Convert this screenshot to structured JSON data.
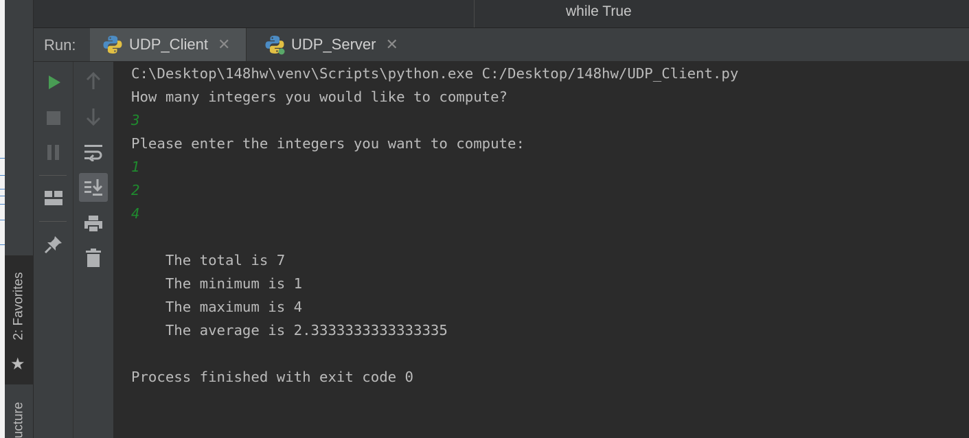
{
  "editor": {
    "code_text": "while True"
  },
  "run_panel": {
    "label": "Run:",
    "tabs": [
      {
        "label": "UDP_Client",
        "active": true
      },
      {
        "label": "UDP_Server",
        "active": false,
        "running": true
      }
    ]
  },
  "toolbar_left": [
    "run-icon",
    "stop-icon",
    "pause-icon",
    "layout-icon",
    "pin-icon"
  ],
  "toolbar_right": [
    "arrow-up-icon",
    "arrow-down-icon",
    "soft-wrap-icon",
    "scroll-to-end-icon",
    "print-icon",
    "trash-icon"
  ],
  "side_tabs": {
    "favorites": "2: Favorites",
    "structure": "ucture"
  },
  "console": {
    "lines": [
      {
        "text": "C:\\Desktop\\148hw\\venv\\Scripts\\python.exe C:/Desktop/148hw/UDP_Client.py",
        "kind": "output"
      },
      {
        "text": "How many integers you would like to compute?",
        "kind": "output"
      },
      {
        "text": "3",
        "kind": "input"
      },
      {
        "text": "Please enter the integers you want to compute:",
        "kind": "output"
      },
      {
        "text": "1",
        "kind": "input"
      },
      {
        "text": "2",
        "kind": "input"
      },
      {
        "text": "4",
        "kind": "input"
      },
      {
        "text": "",
        "kind": "output"
      },
      {
        "text": "    The total is 7",
        "kind": "output"
      },
      {
        "text": "    The minimum is 1",
        "kind": "output"
      },
      {
        "text": "    The maximum is 4",
        "kind": "output"
      },
      {
        "text": "    The average is 2.3333333333333335",
        "kind": "output"
      },
      {
        "text": "",
        "kind": "output"
      },
      {
        "text": "Process finished with exit code 0",
        "kind": "output"
      }
    ]
  },
  "colors": {
    "background": "#2b2b2b",
    "panel": "#3c3f41",
    "console_text": "#bbbbbb",
    "input_text": "#1f8a2e",
    "run_green": "#499c54"
  }
}
